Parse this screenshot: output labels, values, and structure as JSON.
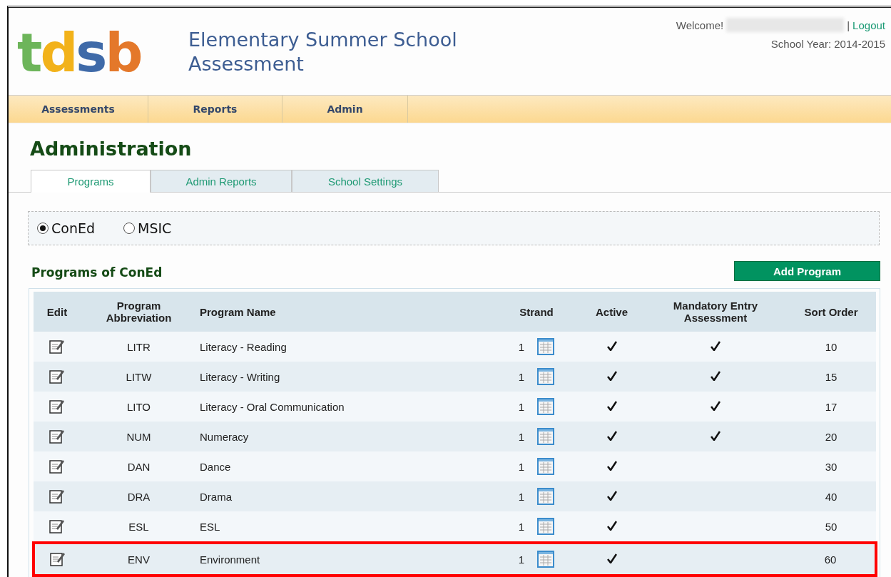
{
  "header": {
    "logo": "tdsb",
    "title_lines": [
      "Elementary Summer School",
      "Assessment"
    ],
    "welcome": "Welcome!",
    "separator": "|",
    "logout": "Logout",
    "school_year": "School Year: 2014-2015"
  },
  "nav": [
    {
      "label": "Assessments"
    },
    {
      "label": "Reports"
    },
    {
      "label": "Admin"
    }
  ],
  "page_title": "Administration",
  "tabs": [
    {
      "label": "Programs",
      "selected": true
    },
    {
      "label": "Admin Reports",
      "selected": false
    },
    {
      "label": "School Settings",
      "selected": false
    }
  ],
  "radios": [
    {
      "label": "ConEd",
      "selected": true
    },
    {
      "label": "MSIC",
      "selected": false
    }
  ],
  "section_title": "Programs of ConEd",
  "add_button": "Add Program",
  "table": {
    "columns": [
      "Edit",
      "Program Abbreviation",
      "Program Name",
      "Strand",
      "Active",
      "Mandatory Entry Assessment",
      "Sort Order"
    ],
    "rows": [
      {
        "abbreviation": "LITR",
        "name": "Literacy - Reading",
        "strand": "1",
        "active": true,
        "mandatory": true,
        "sort_order": "10",
        "highlighted": false
      },
      {
        "abbreviation": "LITW",
        "name": "Literacy - Writing",
        "strand": "1",
        "active": true,
        "mandatory": true,
        "sort_order": "15",
        "highlighted": false
      },
      {
        "abbreviation": "LITO",
        "name": "Literacy - Oral Communication",
        "strand": "1",
        "active": true,
        "mandatory": true,
        "sort_order": "17",
        "highlighted": false
      },
      {
        "abbreviation": "NUM",
        "name": "Numeracy",
        "strand": "1",
        "active": true,
        "mandatory": true,
        "sort_order": "20",
        "highlighted": false
      },
      {
        "abbreviation": "DAN",
        "name": "Dance",
        "strand": "1",
        "active": true,
        "mandatory": false,
        "sort_order": "30",
        "highlighted": false
      },
      {
        "abbreviation": "DRA",
        "name": "Drama",
        "strand": "1",
        "active": true,
        "mandatory": false,
        "sort_order": "40",
        "highlighted": false
      },
      {
        "abbreviation": "ESL",
        "name": "ESL",
        "strand": "1",
        "active": true,
        "mandatory": false,
        "sort_order": "50",
        "highlighted": false
      },
      {
        "abbreviation": "ENV",
        "name": "Environment",
        "strand": "1",
        "active": true,
        "mandatory": false,
        "sort_order": "60",
        "highlighted": true
      }
    ]
  }
}
